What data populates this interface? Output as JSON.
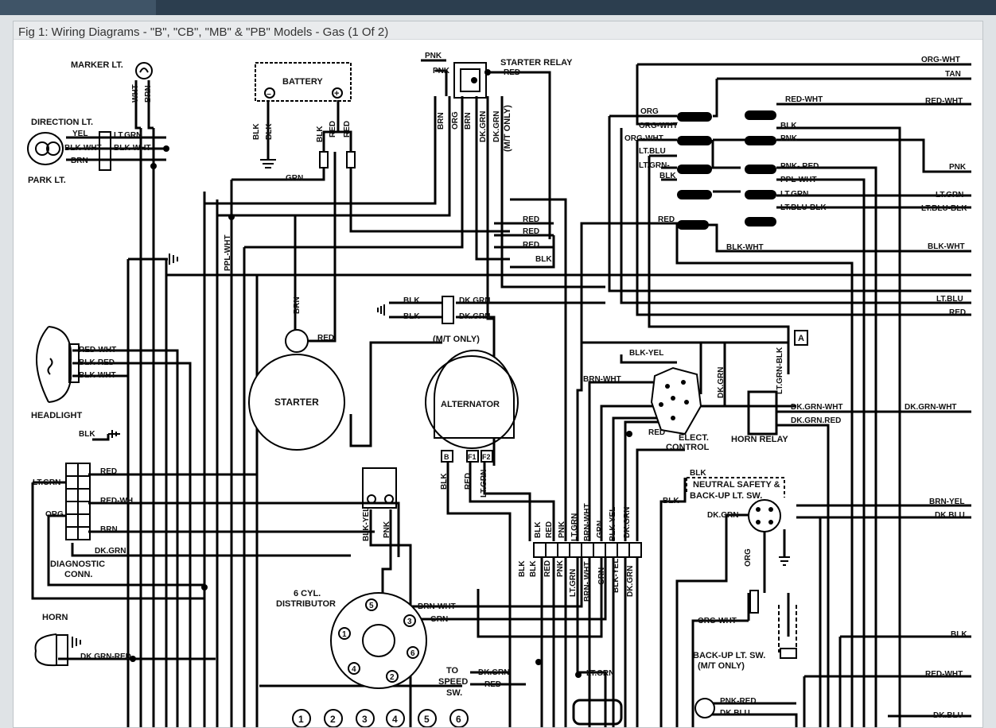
{
  "figure_caption": "Fig 1: Wiring Diagrams - \"B\", \"CB\", \"MB\" & \"PB\" Models - Gas (1 Of 2)",
  "components": {
    "marker_lt": "MARKER LT.",
    "direction_lt": "DIRECTION LT.",
    "park_lt": "PARK LT.",
    "battery": "BATTERY",
    "starter_relay": "STARTER RELAY",
    "mt_only": "(M/T ONLY)",
    "headlight": "HEADLIGHT",
    "starter": "STARTER",
    "alternator": "ALTERNATOR",
    "diagnostic_conn_1": "DIAGNOSTIC",
    "diagnostic_conn_2": "CONN.",
    "horn": "HORN",
    "distributor_1": "6 CYL.",
    "distributor_2": "DISTRIBUTOR",
    "elect_control_1": "ELECT.",
    "elect_control_2": "CONTROL",
    "horn_relay": "HORN RELAY",
    "neutral_safety_1": "NEUTRAL SAFETY &",
    "neutral_safety_2": "BACK-UP LT. SW.",
    "backup_sw_1": "BACK-UP LT. SW.",
    "backup_sw_2": "(M/T ONLY)",
    "speed_sw_1": "TO",
    "speed_sw_2": "SPEED",
    "speed_sw_3": "SW.",
    "connector_a": "A",
    "alt_terminal_b": "B",
    "alt_terminal_f1": "F1",
    "alt_terminal_f2": "F2",
    "plus": "+",
    "minus": "−"
  },
  "firing_order": [
    "1",
    "2",
    "3",
    "4",
    "5",
    "6"
  ],
  "wire_labels": {
    "wht": "WHT",
    "brn": "BRN",
    "yel": "YEL",
    "lt_grn": "LT.GRN",
    "blk_wht": "BLK-WHT",
    "blk": "BLK",
    "red": "RED",
    "grn": "GRN",
    "ppl_wht": "PPL-WHT",
    "pnk": "PNK",
    "org": "ORG",
    "dk_grn": "DK.GRN",
    "red_wht": "RED-WHT",
    "blk_red": "BLK-RED",
    "red_wh": "RED-WH",
    "dk_grn_red": "DK.GRN-RED",
    "org_wht": "ORG-WHT",
    "tan": "TAN",
    "lt_blu": "LT.BLU",
    "lt_grn_blk": "LT.GRN-BLK",
    "pnk_red": "PNK-RED",
    "lt_blu_blk": "LT.BLU-BLK",
    "blk_yel": "BLK-YEL",
    "brn_wht": "BRN-WHT",
    "brn_wht_sp": "BRN- WHT",
    "lt_grn_blk_v": "LT.GRN-BLK",
    "dk_grn_wht": "DK.GRN-WHT",
    "brn_yel": "BRN-YEL",
    "dk_blu": "DK.BLU",
    "blk_yel_v": "BLK-YEL",
    "dk_grnred": "DK.GRN-RED",
    "dk_grn_red_dot": "DK.GRN.RED",
    "pnk_red_sp": "PNK- RED",
    "lt_grn_dash": "LT.GRN-"
  },
  "colors": {
    "wire": "#000000",
    "page_bg": "#ffffff",
    "caption_bg": "#e9ebed",
    "topbar": "#2c3e4f"
  }
}
